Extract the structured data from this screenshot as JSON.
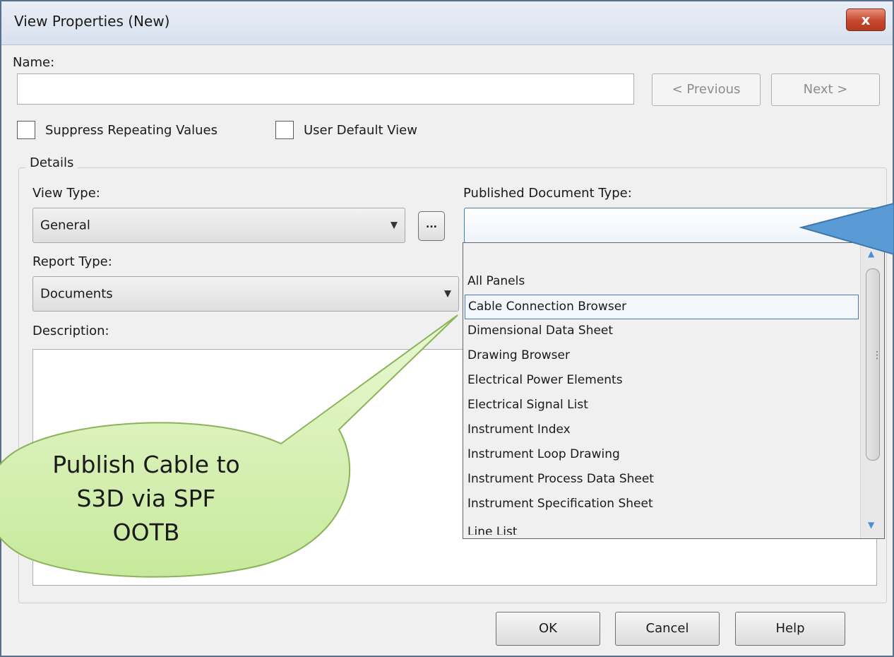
{
  "window": {
    "title": "View Properties (New)",
    "close_label": "x"
  },
  "name_field": {
    "label": "Name:",
    "value": ""
  },
  "nav": {
    "previous_label": "< Previous",
    "next_label": "Next >"
  },
  "options": {
    "suppress_repeating": {
      "label": "Suppress Repeating Values",
      "checked": false
    },
    "user_default_view": {
      "label": "User Default View",
      "checked": false
    }
  },
  "details": {
    "legend": "Details",
    "view_type": {
      "label": "View Type:",
      "value": "General",
      "browse_label": "..."
    },
    "report_type": {
      "label": "Report Type:",
      "value": "Documents"
    },
    "description": {
      "label": "Description:",
      "value": ""
    },
    "published_document_type": {
      "label": "Published Document Type:",
      "value": "",
      "options": [
        "All Panels",
        "Cable Connection Browser",
        "Dimensional Data Sheet",
        "Drawing Browser",
        "Electrical Power Elements",
        "Electrical Signal List",
        "Instrument Index",
        "Instrument Loop Drawing",
        "Instrument Process Data Sheet",
        "Instrument Specification Sheet",
        "Line List"
      ],
      "highlighted": "Cable Connection Browser"
    }
  },
  "footer": {
    "ok_label": "OK",
    "cancel_label": "Cancel",
    "help_label": "Help"
  },
  "annotation": {
    "line1": "Publish Cable to",
    "line2": "S3D via SPF",
    "line3": "OOTB"
  },
  "colors": {
    "callout_fill": "#cfeeaa",
    "callout_border": "#8ab35a",
    "pointer_fill": "#5b9bd5"
  }
}
